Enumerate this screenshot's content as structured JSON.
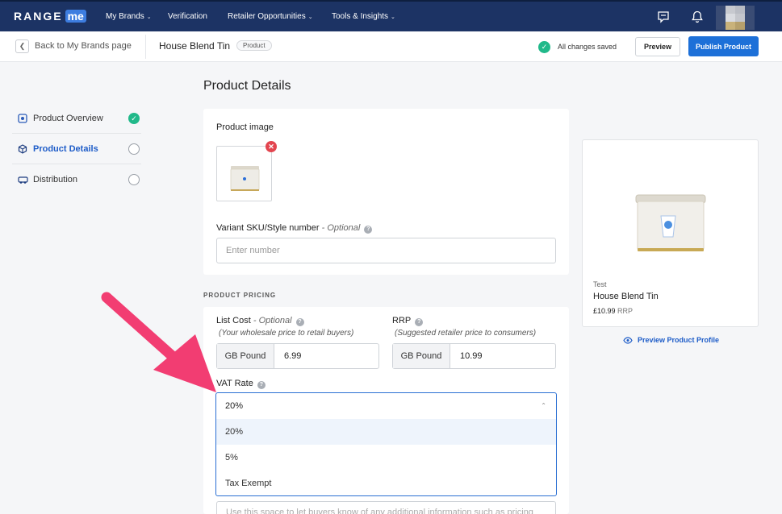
{
  "nav": {
    "logo_text": "RANGE",
    "logo_badge": "me",
    "items": [
      {
        "label": "My Brands"
      },
      {
        "label": "Verification"
      },
      {
        "label": "Retailer Opportunities"
      },
      {
        "label": "Tools & Insights"
      }
    ]
  },
  "subheader": {
    "back_label": "Back to My Brands page",
    "product_name": "House Blend Tin",
    "product_badge": "Product",
    "saved_status": "All changes saved",
    "preview_label": "Preview",
    "publish_label": "Publish Product"
  },
  "sidebar": {
    "items": [
      {
        "label": "Product Overview",
        "state": "complete"
      },
      {
        "label": "Product Details",
        "state": "active"
      },
      {
        "label": "Distribution",
        "state": "incomplete"
      }
    ]
  },
  "main": {
    "title": "Product Details",
    "product_image_label": "Product image",
    "sku_label": "Variant SKU/Style number",
    "sku_optional": " - Optional",
    "sku_placeholder": "Enter number",
    "pricing_heading": "PRODUCT PRICING",
    "list_cost_label": "List Cost",
    "list_cost_optional": "  - Optional",
    "list_cost_hint": "(Your wholesale price to retail buyers)",
    "list_cost_currency": "GB Pound",
    "list_cost_value": "6.99",
    "rrp_label": "RRP",
    "rrp_hint": "(Suggested retailer price to consumers)",
    "rrp_currency": "GB Pound",
    "rrp_value": "10.99",
    "vat_label": "VAT Rate",
    "vat_selected": "20%",
    "vat_options": [
      "20%",
      "5%",
      "Tax Exempt"
    ],
    "notes_placeholder": "Use this space to let buyers know of any additional information such as pricing"
  },
  "preview_card": {
    "brand": "Test",
    "name": "House Blend Tin",
    "price": "£10.99",
    "price_suffix": "RRP",
    "link_label": "Preview Product Profile"
  },
  "colors": {
    "nav_bg": "#1c3364",
    "primary": "#1d70d8",
    "success": "#21b98a",
    "danger": "#e3454f",
    "annotation_arrow": "#f23d72"
  }
}
